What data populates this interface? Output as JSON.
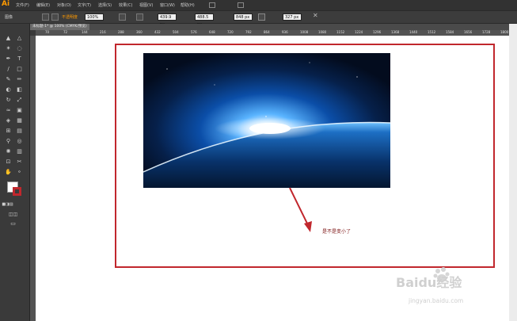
{
  "app": {
    "logo": "Ai"
  },
  "menubar": {
    "items": [
      "文件(F)",
      "编辑(E)",
      "对象(O)",
      "文字(T)",
      "选择(S)",
      "效果(C)",
      "视图(V)",
      "窗口(W)",
      "帮助(H)"
    ]
  },
  "controlbar": {
    "label": "图像",
    "orange_label": "不透明度",
    "opacity_value": "100%",
    "x_value": "439.9 px",
    "y_value": "488.5 px",
    "w_value": "848 px",
    "h_value": "327 px"
  },
  "document": {
    "tab_title": "未标题-1* @ 100% (CMYK/预览)"
  },
  "ruler": {
    "ticks": [
      "70",
      "72",
      "144",
      "216",
      "288",
      "360",
      "432",
      "504",
      "576",
      "648",
      "720",
      "792",
      "864",
      "936",
      "1008",
      "1080",
      "1152",
      "1224",
      "1296",
      "1368",
      "1440",
      "1512",
      "1584",
      "1656",
      "1728",
      "1800"
    ]
  },
  "annotation": {
    "text": "是不是变小了",
    "color": "#c1272d"
  },
  "watermark": {
    "brand": "Baidu经验",
    "url": "jingyan.baidu.com"
  }
}
